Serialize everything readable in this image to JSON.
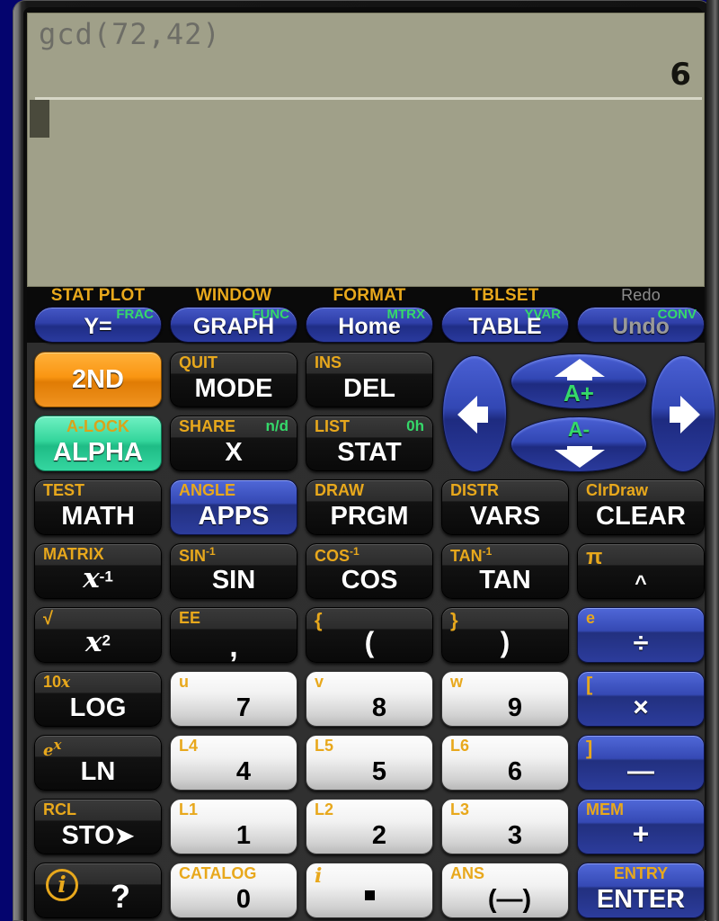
{
  "device": {
    "name": "graphing-calculator-emulator",
    "frame_color": "#04046e",
    "lcd_color": "#a0a089"
  },
  "display": {
    "entry": "gcd(72,42)",
    "result": "6",
    "cursor_visible": true
  },
  "function_row": [
    {
      "second": "STAT PLOT",
      "alpha": "FRAC",
      "label": "Y=",
      "name": "y-equals",
      "disabled": false
    },
    {
      "second": "WINDOW",
      "alpha": "FUNC",
      "label": "GRAPH",
      "name": "graph",
      "disabled": false
    },
    {
      "second": "FORMAT",
      "alpha": "MTRX",
      "label": "Home",
      "name": "home",
      "disabled": false
    },
    {
      "second": "TBLSET",
      "alpha": "YVAR",
      "label": "TABLE",
      "name": "table",
      "disabled": false
    },
    {
      "second": "Redo",
      "alpha": "CONV",
      "label": "Undo",
      "name": "undo",
      "disabled": true
    }
  ],
  "keys": {
    "second": {
      "label": "2ND",
      "second": ""
    },
    "alpha": {
      "label": "ALPHA",
      "second": "A-LOCK"
    },
    "mode": {
      "label": "MODE",
      "second": "QUIT"
    },
    "del": {
      "label": "DEL",
      "second": "INS"
    },
    "x": {
      "label": "X",
      "second": "SHARE",
      "alpha": "n/d"
    },
    "stat": {
      "label": "STAT",
      "second": "LIST",
      "alpha": "0h"
    },
    "math": {
      "label": "MATH",
      "second": "TEST"
    },
    "apps": {
      "label": "APPS",
      "second": "ANGLE"
    },
    "prgm": {
      "label": "PRGM",
      "second": "DRAW"
    },
    "vars": {
      "label": "VARS",
      "second": "DISTR"
    },
    "clear": {
      "label": "CLEAR",
      "second": "ClrDraw"
    },
    "xinv": {
      "label": "x-1",
      "second": "MATRIX"
    },
    "sin": {
      "label": "SIN",
      "second": "SIN-1"
    },
    "cos": {
      "label": "COS",
      "second": "COS-1"
    },
    "tan": {
      "label": "TAN",
      "second": "TAN-1"
    },
    "power": {
      "label": "^",
      "second": "π"
    },
    "xsq": {
      "label": "x2",
      "second": "√"
    },
    "comma": {
      "label": ",",
      "second": "EE"
    },
    "lparen": {
      "label": "(",
      "second": "{"
    },
    "rparen": {
      "label": ")",
      "second": "}"
    },
    "divide": {
      "label": "÷",
      "second": "e"
    },
    "log": {
      "label": "LOG",
      "second": "10x"
    },
    "seven": {
      "label": "7",
      "second": "u"
    },
    "eight": {
      "label": "8",
      "second": "v"
    },
    "nine": {
      "label": "9",
      "second": "w"
    },
    "multiply": {
      "label": "×",
      "second": "["
    },
    "ln": {
      "label": "LN",
      "second": "ex"
    },
    "four": {
      "label": "4",
      "second": "L4"
    },
    "five": {
      "label": "5",
      "second": "L5"
    },
    "six": {
      "label": "6",
      "second": "L6"
    },
    "minus": {
      "label": "—",
      "second": "]"
    },
    "sto": {
      "label": "STO",
      "second": "RCL"
    },
    "one": {
      "label": "1",
      "second": "L1"
    },
    "two": {
      "label": "2",
      "second": "L2"
    },
    "three": {
      "label": "3",
      "second": "L3"
    },
    "plus": {
      "label": "+",
      "second": "MEM"
    },
    "help": {
      "label": "?",
      "second": "i"
    },
    "zero": {
      "label": "0",
      "second": "CATALOG"
    },
    "decimal": {
      "label": ".",
      "second": "i"
    },
    "negate": {
      "label": "(—)",
      "second": "ANS"
    },
    "enter": {
      "label": "ENTER",
      "second": "ENTRY"
    }
  },
  "dpad": {
    "up_alpha": "A+",
    "down_alpha": "A-"
  },
  "colors": {
    "second_fn": "#e8a81c",
    "alpha_fn": "#35d96a",
    "blue_key": "#2f3fa8",
    "orange_key": "#fa9612",
    "teal_key": "#34d69c",
    "disabled": "#9a9a9a"
  }
}
